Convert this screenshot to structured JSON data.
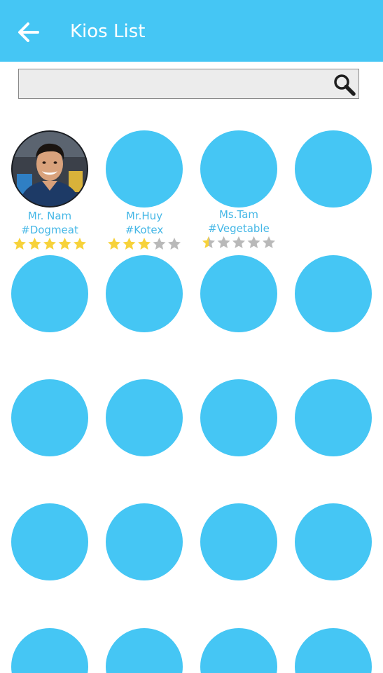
{
  "header": {
    "title": "Kios List",
    "back_icon": "arrow-left-icon",
    "background": "#45c6f4"
  },
  "search": {
    "value": "",
    "placeholder": "",
    "icon": "search-icon"
  },
  "kiosks": [
    {
      "name": "Mr. Nam",
      "tag": "#Dogmeat",
      "rating": 5,
      "max_rating": 5,
      "photo": true
    },
    {
      "name": "Mr.Huy",
      "tag": "#Kotex",
      "rating": 3,
      "max_rating": 5,
      "photo": false
    },
    {
      "name": "Ms.Tam",
      "tag": "#Vegetable",
      "rating": 0.5,
      "max_rating": 5,
      "photo": false
    }
  ],
  "colors": {
    "accent": "#45c6f4",
    "label": "#45b7e6",
    "star_filled": "#f7d23a",
    "star_empty": "#b9b9b9"
  }
}
